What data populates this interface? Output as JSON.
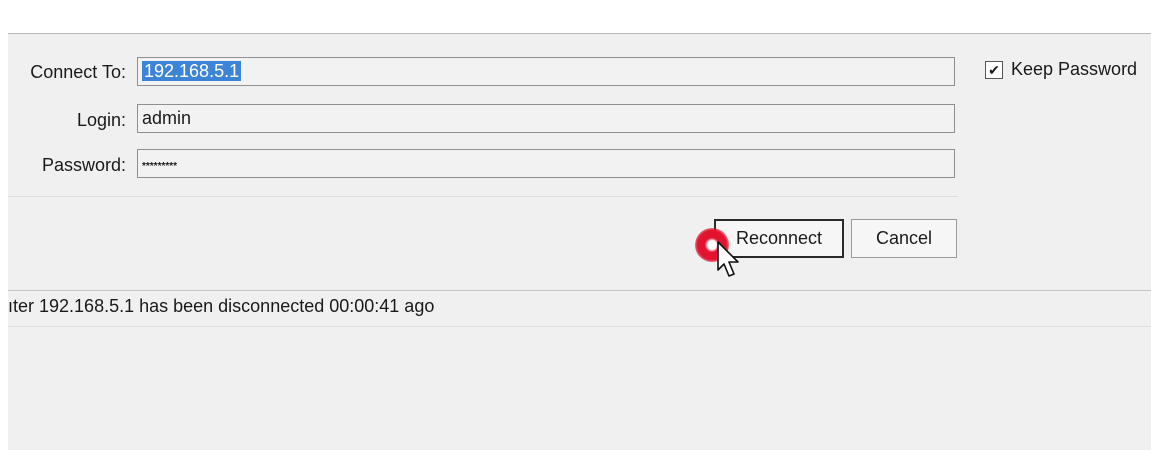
{
  "form": {
    "connect_to_label": "Connect To:",
    "connect_to_value": "192.168.5.1",
    "login_label": "Login:",
    "login_value": "admin",
    "password_label": "Password:",
    "password_value": "*********",
    "keep_password_label": "Keep Password",
    "keep_password_checked": true
  },
  "buttons": {
    "reconnect": "Reconnect",
    "cancel": "Cancel"
  },
  "status": {
    "message": "ıter 192.168.5.1 has been disconnected 00:00:41 ago"
  },
  "icons": {
    "cursor": "mouse-pointer-icon",
    "click_indicator": "click-indicator-icon",
    "checkmark": "checkmark-icon"
  },
  "colors": {
    "selection": "#3d84d6",
    "click_indicator": "#e3132f",
    "panel_background": "#f0f0f0"
  }
}
